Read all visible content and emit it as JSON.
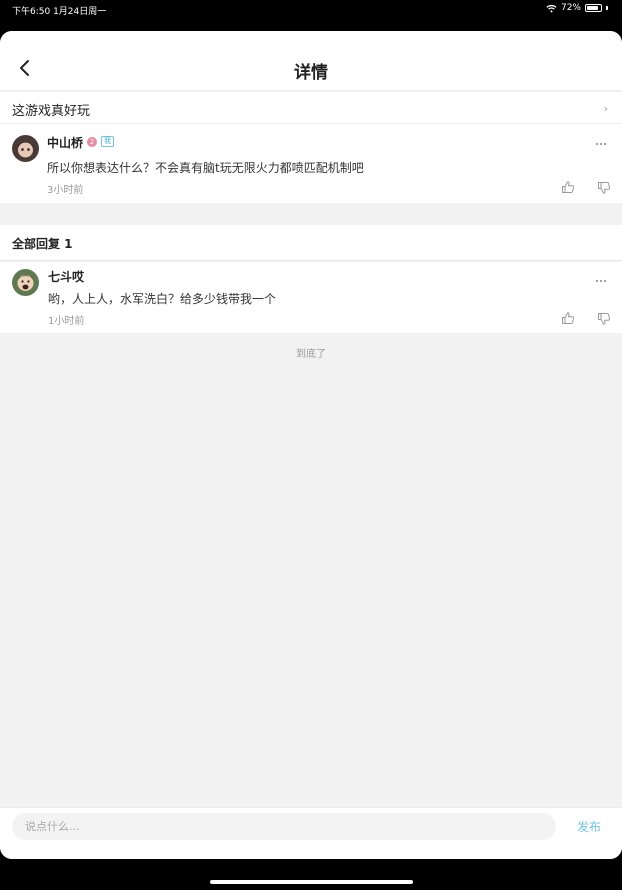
{
  "status_bar": {
    "time_date": "下午6:50   1月24日周一",
    "battery_percent": "72%",
    "battery_level": 0.72
  },
  "nav": {
    "title": "详情"
  },
  "topic": {
    "title": "这游戏真好玩"
  },
  "post": {
    "author": "中山桥",
    "level": "2",
    "me_badge": "我",
    "content": "所以你想表达什么？不会真有脑t玩无限火力都喷匹配机制吧",
    "time": "3小时前"
  },
  "replies": {
    "header": "全部回复 1",
    "items": [
      {
        "author": "七斗哎",
        "content": "哟，人上人，水军洗白？给多少钱带我一个",
        "time": "1小时前"
      }
    ]
  },
  "end_text": "到底了",
  "bottom_bar": {
    "placeholder": "说点什么...",
    "publish_label": "发布"
  }
}
